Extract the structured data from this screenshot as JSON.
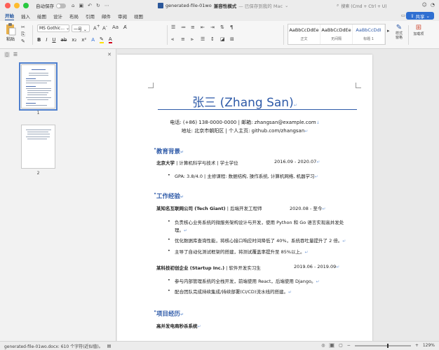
{
  "titlebar": {
    "autosave_label": "自动保存",
    "doc_name": "generated-file-01wo",
    "compat_mode": "兼容性模式",
    "saved_status": "— 已保存到我的 Mac",
    "search_placeholder": "搜索 (Cmd + Ctrl + U)"
  },
  "menu": {
    "tabs": [
      "开始",
      "插入",
      "绘图",
      "设计",
      "布局",
      "引用",
      "邮件",
      "审阅",
      "视图"
    ],
    "share_label": "共享"
  },
  "ribbon": {
    "paste_label": "粘贴",
    "font_name": "MS Gothic...",
    "font_size": "一号",
    "styles": [
      {
        "sample": "AaBbCcDdEe",
        "name": "正文"
      },
      {
        "sample": "AaBbCcDdEe",
        "name": "无间隔"
      },
      {
        "sample": "AaBbCcDdI",
        "name": "标题 1"
      }
    ],
    "styles_pane_label": "样式\n窗格",
    "addins_label": "加载项"
  },
  "nav": {
    "page_numbers": [
      "1",
      "2"
    ]
  },
  "document": {
    "name": "张三 (Zhang San)",
    "contact1": "电话: (+86) 138-0000-0000 | 邮箱: zhangsan@example.com",
    "contact2": "地址: 北京市朝阳区 | 个人主页: github.com/zhangsan",
    "sections": {
      "education": "教育背景",
      "work": "工作经验",
      "projects": "项目经历"
    },
    "edu": {
      "school": "北京大学",
      "detail": " | 计算机科学与技术 | 学士学位",
      "dates": "2016.09 - 2020.07",
      "gpa": "GPA: 3.8/4.0 | 主修课程: 数据结构, 操作系统, 计算机网络, 机器学习"
    },
    "job1": {
      "company": "某知名互联网公司 (Tech Giant)",
      "role": " | 后端开发工程师",
      "dates": "2020.08 - 至今",
      "bullets": [
        "负责核心业务系统的微服务架构设计与开发，使用 Python 和 Go 语言实现高并发处",
        "理。",
        "优化数据库查询性能，将核心接口响应时间降低了 40%，系统吞吐量提升了 2 倍。",
        "主导了自动化测试框架的搭建，将测试覆盖率提升至 85%以上。"
      ]
    },
    "job2": {
      "company": "某科技初创企业 (Startup Inc.)",
      "role": " | 软件开发实习生",
      "dates": "2019.06 - 2019.09",
      "bullets": [
        "参与内部管理系统的全栈开发，前端使用 React，后端使用 Django。",
        "配合团队完成持续集成/持续部署(CI/CD)流水线的搭建。"
      ]
    },
    "project1": "高并发电商秒杀系统"
  },
  "status": {
    "left": "generated-file-01wo.docx: 610 个字符(近似值)。",
    "zoom": "129%"
  },
  "colors": {
    "accent": "#2e5aa8",
    "share": "#2f6fd1"
  }
}
